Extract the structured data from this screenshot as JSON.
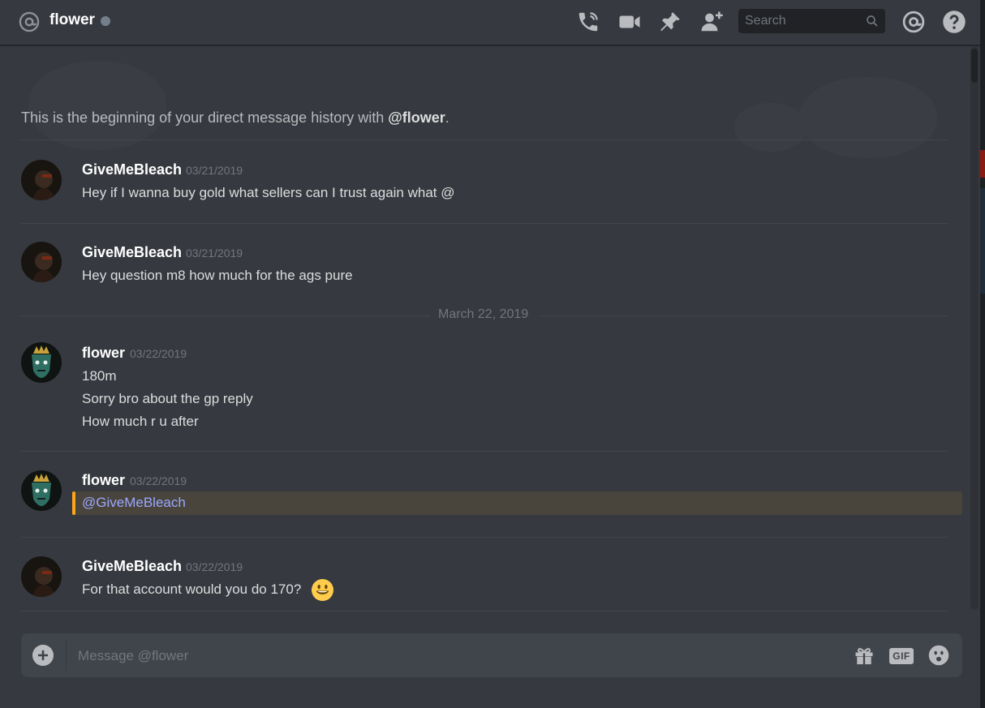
{
  "header": {
    "channel_name": "flower",
    "search_placeholder": "Search",
    "icons": [
      "at-icon",
      "call-icon",
      "video-icon",
      "pin-icon",
      "add-friend-icon",
      "search-icon",
      "mention-icon",
      "help-icon"
    ]
  },
  "beginning": {
    "prefix": "This is the beginning of your direct message history with ",
    "user": "@flower",
    "suffix": "."
  },
  "messages": [
    {
      "author": "GiveMeBleach",
      "timestamp": "03/21/2019",
      "lines": [
        "Hey if I wanna buy gold what sellers can I trust again what @"
      ]
    },
    {
      "author": "GiveMeBleach",
      "timestamp": "03/21/2019",
      "lines": [
        "Hey question m8 how much for the ags pure"
      ]
    },
    {
      "author": "flower",
      "timestamp": "03/22/2019",
      "lines": [
        "180m",
        "Sorry bro about the gp reply",
        "How much r u after"
      ]
    },
    {
      "author": "flower",
      "timestamp": "03/22/2019",
      "mention": "@GiveMeBleach"
    },
    {
      "author": "GiveMeBleach",
      "timestamp": "03/22/2019",
      "lines": [
        "For that account would you do 170?"
      ],
      "emoji": "smiley-icon"
    }
  ],
  "date_separator": "March 22, 2019",
  "composer": {
    "placeholder": "Message @flower",
    "gif_label": "GIF",
    "icons": [
      "add-attachment-icon",
      "gift-icon",
      "gif-icon",
      "emoji-picker-icon"
    ]
  },
  "colors": {
    "background": "#36393f",
    "mention_highlight": "#49443c",
    "mention_bar": "#faa61a",
    "mention_text": "#9aa8ff",
    "composer": "#40444b"
  }
}
